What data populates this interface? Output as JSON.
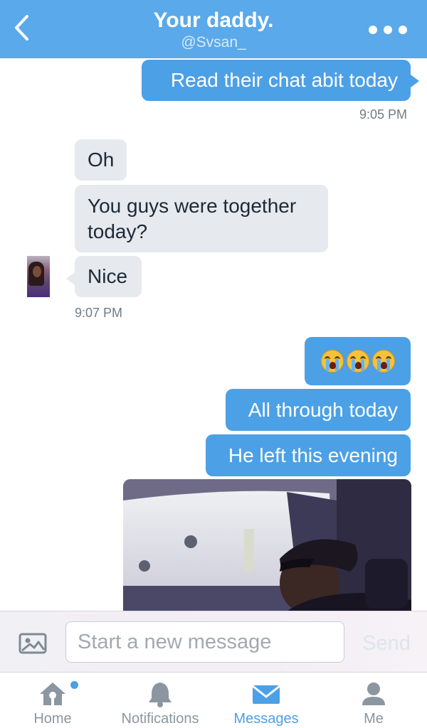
{
  "header": {
    "title": "Your daddy.",
    "handle": "@Svsan_",
    "back_icon": "chevron-left-icon",
    "more_icon": "more-dots-icon"
  },
  "messages": {
    "m1": {
      "text": "Read their chat abit today",
      "direction": "outgoing"
    },
    "t1": "9:05 PM",
    "m2": {
      "text": "Oh",
      "direction": "incoming"
    },
    "m3": {
      "text": "You guys were together today?",
      "direction": "incoming"
    },
    "m4": {
      "text": "Nice",
      "direction": "incoming"
    },
    "t2": "9:07 PM",
    "m5": {
      "emoji": [
        "loudly-crying-face",
        "loudly-crying-face",
        "loudly-crying-face"
      ],
      "direction": "outgoing"
    },
    "m6": {
      "text": "All through today",
      "direction": "outgoing"
    },
    "m7": {
      "text": "He left this evening",
      "direction": "outgoing"
    },
    "m8": {
      "type": "photo",
      "direction": "outgoing"
    }
  },
  "composer": {
    "placeholder": "Start a new message",
    "send_label": "Send",
    "image_icon": "image-icon"
  },
  "tabs": [
    {
      "label": "Home",
      "icon": "home-icon",
      "badge": true,
      "active": false
    },
    {
      "label": "Notifications",
      "icon": "bell-icon",
      "active": false
    },
    {
      "label": "Messages",
      "icon": "envelope-icon",
      "active": true
    },
    {
      "label": "Me",
      "icon": "person-icon",
      "active": false
    }
  ],
  "colors": {
    "header_blue": "#5aa9ea",
    "outgoing_bubble": "#4ca0e6",
    "incoming_bubble": "#e6e9ee",
    "active_tab": "#4ca0e6",
    "inactive_tab": "#8b96a0"
  }
}
